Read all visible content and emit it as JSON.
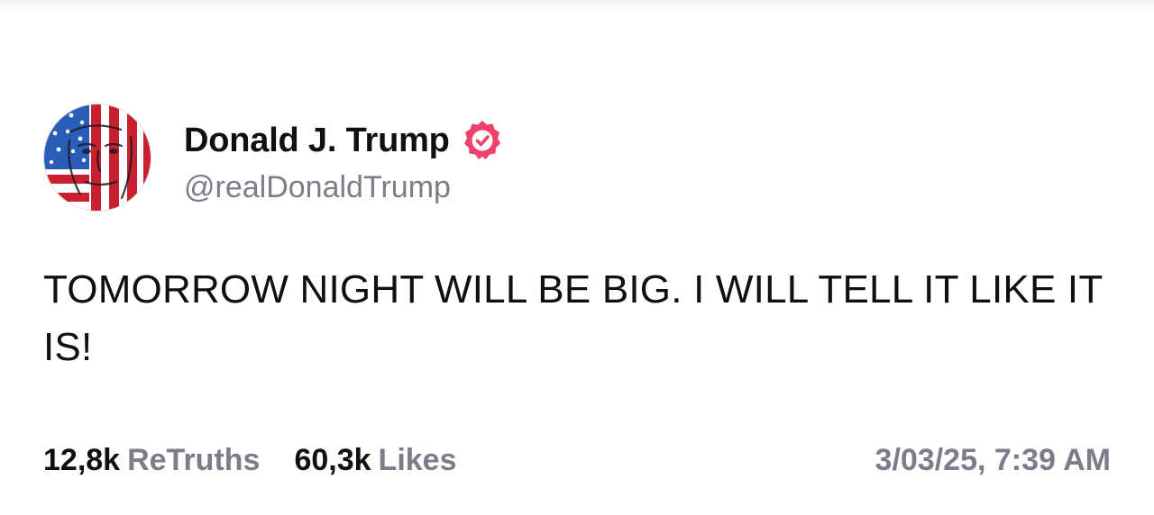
{
  "post": {
    "author": {
      "display_name": "Donald J. Trump",
      "handle": "@realDonaldTrump",
      "verified": true,
      "verified_color": "#f0416c",
      "avatar_icon": "flag-portrait-avatar"
    },
    "text": "TOMORROW NIGHT WILL BE BIG. I WILL TELL IT LIKE IT IS!",
    "stats": {
      "retruths_count": "12,8k",
      "retruths_label": "ReTruths",
      "likes_count": "60,3k",
      "likes_label": "Likes"
    },
    "timestamp": "3/03/25, 7:39 AM"
  },
  "colors": {
    "text_primary": "#0f0f14",
    "text_secondary": "#7d7d8a",
    "flag_red": "#c8202e",
    "flag_blue": "#2a5db8"
  }
}
